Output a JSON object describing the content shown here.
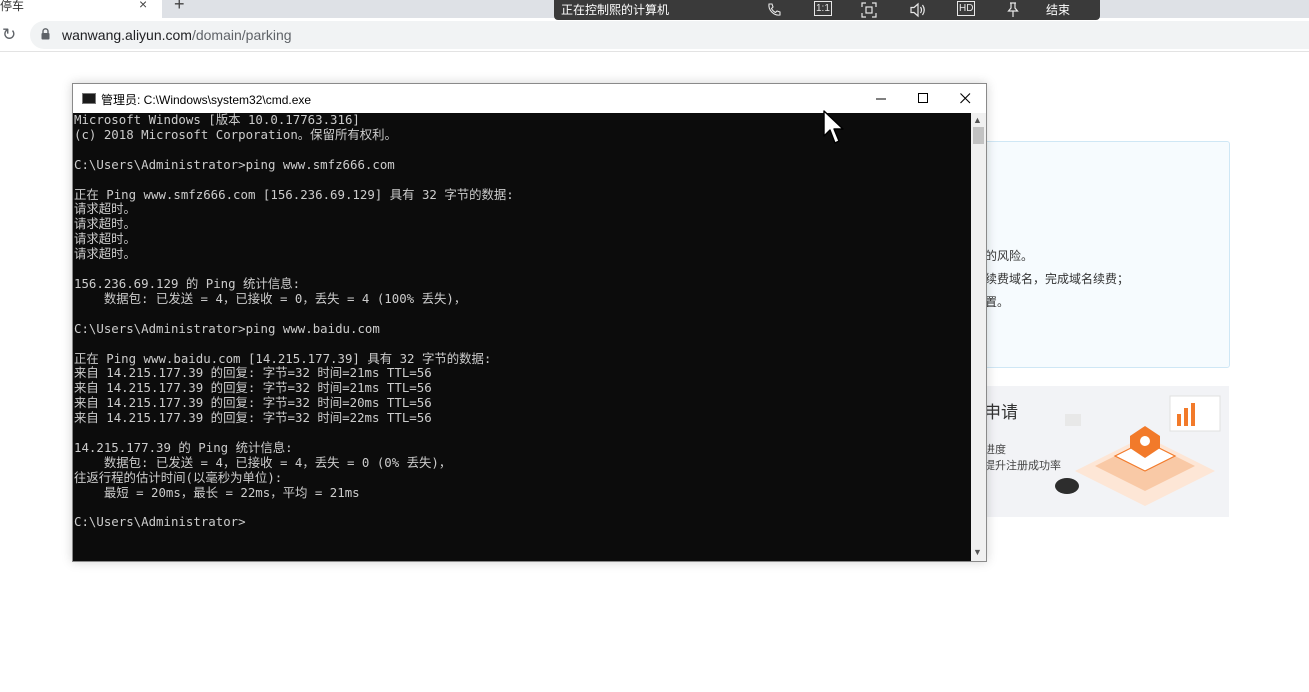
{
  "browser": {
    "tab_title": "停车",
    "tab_close": "×",
    "new_tab": "+",
    "url_host": "wanwang.aliyun.com",
    "url_path": "/domain/parking"
  },
  "remote_bar": {
    "title": "正在控制熙的计算机",
    "ratio_label": "1:1",
    "hd_label": "HD",
    "end_label": "结束"
  },
  "web_page": {
    "info_lines": [
      "的风险。",
      "续费域名，完成域名续费；",
      "置。"
    ],
    "promo_title": "申请",
    "promo_lines": [
      "进度",
      "提升注册成功率"
    ]
  },
  "cmd_window": {
    "title": "管理员: C:\\Windows\\system32\\cmd.exe",
    "console_lines": [
      "Microsoft Windows [版本 10.0.17763.316]",
      "(c) 2018 Microsoft Corporation。保留所有权利。",
      "",
      "C:\\Users\\Administrator>ping www.smfz666.com",
      "",
      "正在 Ping www.smfz666.com [156.236.69.129] 具有 32 字节的数据:",
      "请求超时。",
      "请求超时。",
      "请求超时。",
      "请求超时。",
      "",
      "156.236.69.129 的 Ping 统计信息:",
      "    数据包: 已发送 = 4，已接收 = 0，丢失 = 4 (100% 丢失)，",
      "",
      "C:\\Users\\Administrator>ping www.baidu.com",
      "",
      "正在 Ping www.baidu.com [14.215.177.39] 具有 32 字节的数据:",
      "来自 14.215.177.39 的回复: 字节=32 时间=21ms TTL=56",
      "来自 14.215.177.39 的回复: 字节=32 时间=21ms TTL=56",
      "来自 14.215.177.39 的回复: 字节=32 时间=20ms TTL=56",
      "来自 14.215.177.39 的回复: 字节=32 时间=22ms TTL=56",
      "",
      "14.215.177.39 的 Ping 统计信息:",
      "    数据包: 已发送 = 4，已接收 = 4，丢失 = 0 (0% 丢失)，",
      "往返行程的估计时间(以毫秒为单位):",
      "    最短 = 20ms，最长 = 22ms，平均 = 21ms",
      "",
      "C:\\Users\\Administrator>"
    ]
  },
  "colors": {
    "console_bg": "#0c0c0c",
    "console_fg": "#cccccc",
    "remote_bar_bg": "#3a3a3a",
    "info_card_bg": "#f6fbfe",
    "promo_accent": "#f27a2a"
  },
  "icons": {
    "reload": "reload-icon",
    "lock": "lock-icon",
    "phone": "phone-icon",
    "fit_screen": "fit-screen-icon",
    "volume": "volume-icon",
    "pin": "pin-icon",
    "minimize": "minimize-icon",
    "maximize": "maximize-icon",
    "close": "close-icon"
  }
}
